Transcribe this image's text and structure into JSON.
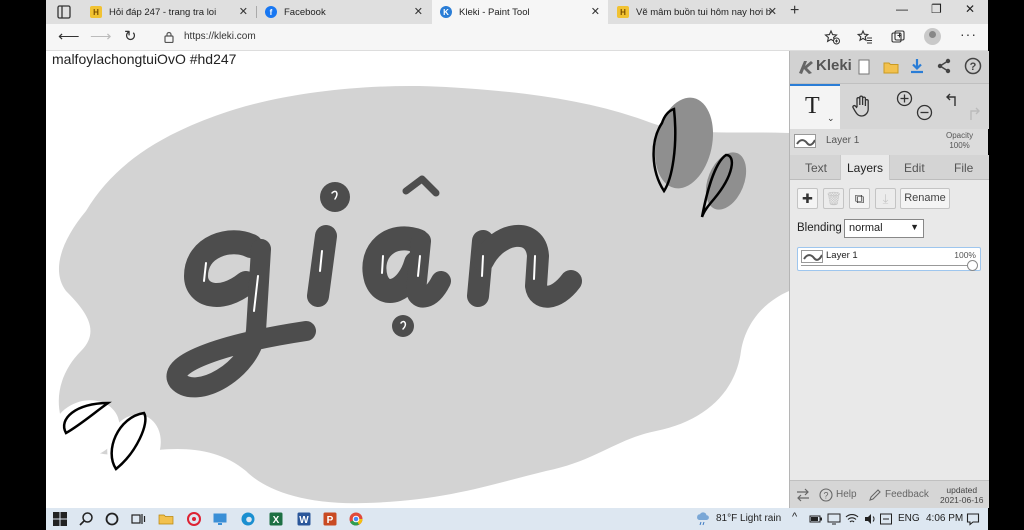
{
  "browser": {
    "tabs": [
      {
        "title": "Hỏi đáp 247 - trang tra loi",
        "favicon": "h-247-icon",
        "active": false
      },
      {
        "title": "Facebook",
        "favicon": "facebook-icon",
        "active": false
      },
      {
        "title": "Kleki - Paint Tool",
        "favicon": "kleki-icon",
        "active": true
      },
      {
        "title": "Vẽ mâm buồn tui hôm nay hơi b",
        "favicon": "h-247-icon",
        "active": false
      }
    ],
    "new_tab_label": "+",
    "url": "https://kleki.com",
    "window_controls": {
      "minimize": "—",
      "restore": "❐",
      "close": "✕"
    }
  },
  "canvas": {
    "caption": "malfoylachongtuiOvO     #hd247",
    "artwork_word": "giận",
    "colors": {
      "background": "#ffffff",
      "blob": "#d3d3d3",
      "lettering": "#4d4d4d",
      "outline": "#000000"
    }
  },
  "kleki": {
    "logo": "Kleki",
    "tools": {
      "text_tool_glyph": "T",
      "caret": "⌄"
    },
    "layer_header": {
      "name": "Layer 1",
      "opacity_label": "Opacity",
      "opacity_value": "100%"
    },
    "tabs": [
      {
        "label": "Text",
        "active": false
      },
      {
        "label": "Layers",
        "active": true
      },
      {
        "label": "Edit",
        "active": false
      },
      {
        "label": "File",
        "active": false
      }
    ],
    "layer_buttons": {
      "add": "✚",
      "delete": "🗑",
      "duplicate": "⧉",
      "merge": "⤓",
      "rename": "Rename"
    },
    "blending_label": "Blending",
    "blending_value": "normal",
    "layers": [
      {
        "name": "Layer 1",
        "opacity": "100%",
        "opacity_fraction": 1.0
      }
    ],
    "footer": {
      "help": "Help",
      "feedback": "Feedback",
      "updated_label": "updated",
      "updated_date": "2021-06-16"
    },
    "accent": "#2a7dd6"
  },
  "taskbar": {
    "weather": "81°F  Light rain",
    "language": "ENG",
    "time": "4:06 PM"
  }
}
